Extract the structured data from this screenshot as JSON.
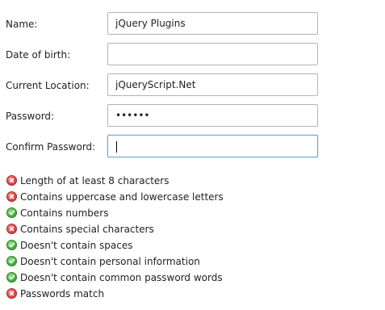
{
  "form": {
    "fields": [
      {
        "label": "Name:",
        "value": "jQuery Plugins",
        "type": "text"
      },
      {
        "label": "Date of birth:",
        "value": "",
        "type": "text"
      },
      {
        "label": "Current Location:",
        "value": "jQueryScript.Net",
        "type": "text"
      },
      {
        "label": "Password:",
        "value": "abcdef",
        "type": "password"
      },
      {
        "label": "Confirm Password:",
        "value": "",
        "type": "password",
        "focused": true
      }
    ]
  },
  "rules": [
    {
      "text": "Length of at least 8 characters",
      "status": "fail",
      "icon": "cross-circle-icon"
    },
    {
      "text": "Contains uppercase and lowercase letters",
      "status": "fail",
      "icon": "cross-circle-icon"
    },
    {
      "text": "Contains numbers",
      "status": "pass",
      "icon": "check-circle-icon"
    },
    {
      "text": "Contains special characters",
      "status": "fail",
      "icon": "cross-circle-icon"
    },
    {
      "text": "Doesn't contain spaces",
      "status": "pass",
      "icon": "check-circle-icon"
    },
    {
      "text": "Doesn't contain personal information",
      "status": "pass",
      "icon": "check-circle-icon"
    },
    {
      "text": "Doesn't contain common password words",
      "status": "pass",
      "icon": "check-circle-icon"
    },
    {
      "text": "Passwords match",
      "status": "fail",
      "icon": "cross-circle-icon"
    }
  ],
  "colors": {
    "pass": "#4db548",
    "fail": "#de4b4b",
    "focus_border": "#6aa6d6",
    "input_border": "#b3b3b3"
  }
}
